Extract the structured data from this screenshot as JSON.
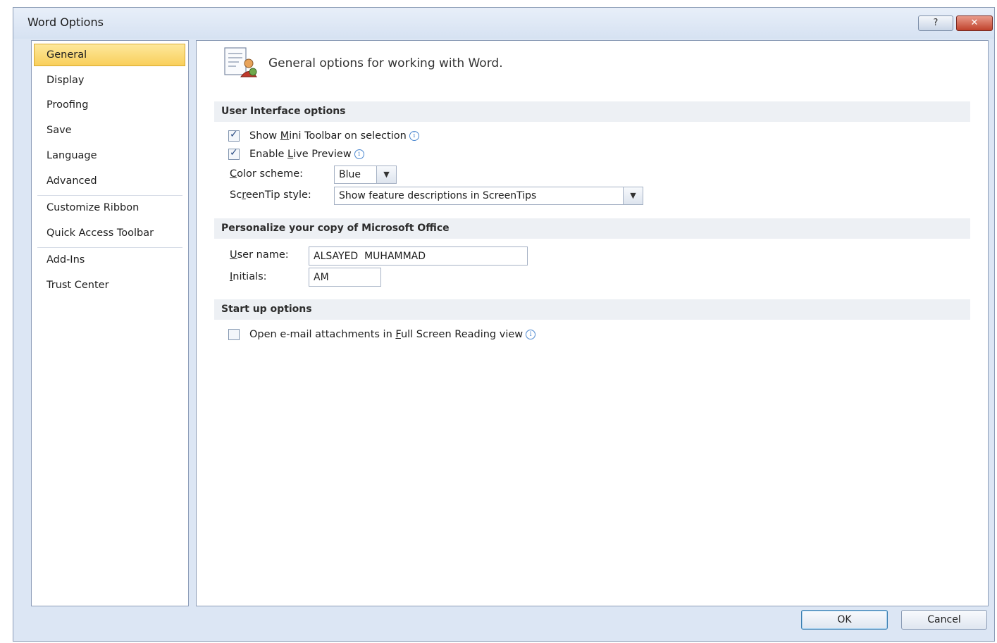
{
  "window": {
    "title": "Word Options",
    "help_glyph": "?",
    "close_glyph": "✕"
  },
  "sidebar": {
    "items": [
      {
        "label": "General",
        "selected": true
      },
      {
        "label": "Display"
      },
      {
        "label": "Proofing"
      },
      {
        "label": "Save"
      },
      {
        "label": "Language"
      },
      {
        "label": "Advanced"
      },
      {
        "label": "Customize Ribbon"
      },
      {
        "label": "Quick Access Toolbar"
      },
      {
        "label": "Add-Ins"
      },
      {
        "label": "Trust Center"
      }
    ]
  },
  "main": {
    "header_icon": "general-options-icon",
    "header_text": "General options for working with Word.",
    "sections": {
      "ui": {
        "title": "User Interface options",
        "mini_toolbar": {
          "pre": "Show ",
          "key": "M",
          "post": "ini Toolbar on selection",
          "checked": true
        },
        "live_preview": {
          "pre": "Enable ",
          "key": "L",
          "post": "ive Preview",
          "checked": true
        },
        "color_scheme": {
          "label_key": "C",
          "label_rest": "olor scheme:",
          "value": "Blue"
        },
        "screentip": {
          "label_pre": "Sc",
          "label_key": "r",
          "label_post": "eenTip style:",
          "value": "Show feature descriptions in ScreenTips"
        }
      },
      "personalize": {
        "title": "Personalize your copy of Microsoft Office",
        "user_name": {
          "label_key": "U",
          "label_rest": "ser name:",
          "value": "ALSAYED  MUHAMMAD"
        },
        "initials": {
          "label_key": "I",
          "label_rest": "nitials:",
          "value": "AM"
        }
      },
      "startup": {
        "title": "Start up options",
        "full_screen": {
          "pre": "Open e-mail attachments in ",
          "key": "F",
          "post": "ull Screen Reading view",
          "checked": false
        }
      }
    }
  },
  "footer": {
    "ok_label": "OK",
    "cancel_label": "Cancel"
  },
  "glyphs": {
    "check": "✓",
    "info": "i",
    "dropdown_arrow": "▼"
  },
  "colors": {
    "selected_nav": "#f9cf5b",
    "window_frame": "#dce6f4",
    "section_band": "#edf0f4"
  }
}
